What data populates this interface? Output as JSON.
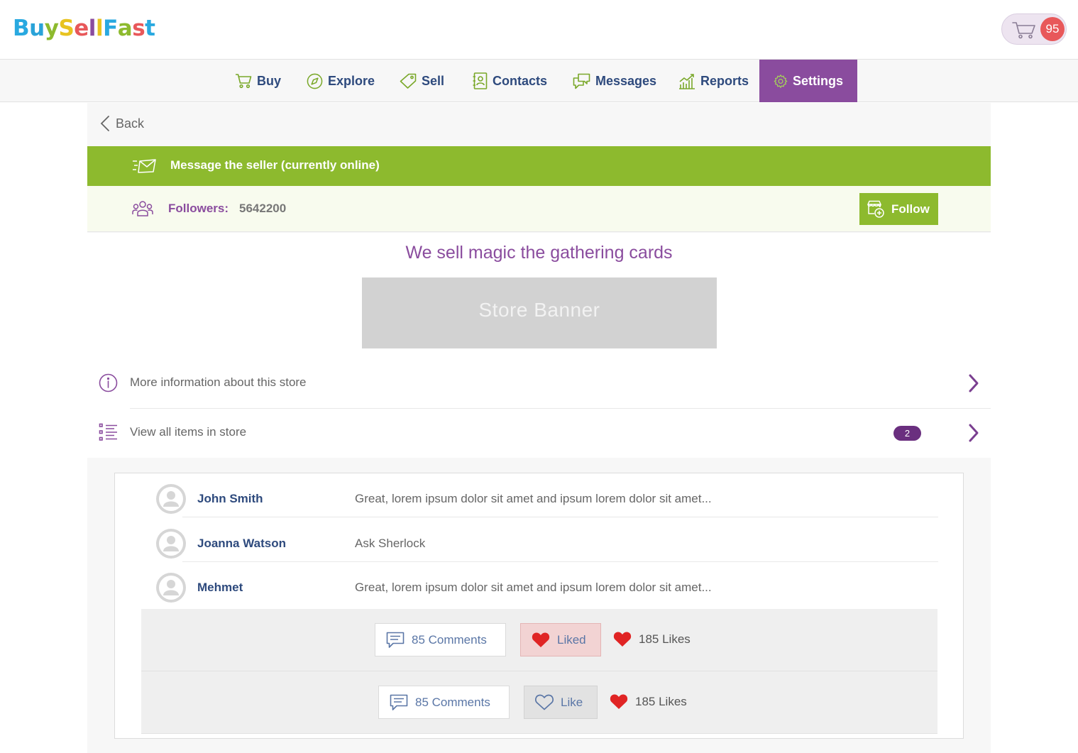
{
  "app": {
    "logo_letters": [
      {
        "ch": "B",
        "color": "#29a9e0"
      },
      {
        "ch": "u",
        "color": "#2aa3d8"
      },
      {
        "ch": "y",
        "color": "#8dba2e"
      },
      {
        "ch": "S",
        "color": "#e8c320"
      },
      {
        "ch": "e",
        "color": "#e8585a"
      },
      {
        "ch": "l",
        "color": "#8a4c9e"
      },
      {
        "ch": "l",
        "color": "#e8c320"
      },
      {
        "ch": "F",
        "color": "#29a9e0"
      },
      {
        "ch": "a",
        "color": "#8dba2e"
      },
      {
        "ch": "s",
        "color": "#e8585a"
      },
      {
        "ch": "t",
        "color": "#29a9e0"
      }
    ],
    "cart_count": "95"
  },
  "nav": {
    "items": [
      {
        "label": "Buy",
        "icon": "cart-icon"
      },
      {
        "label": "Explore",
        "icon": "compass-icon"
      },
      {
        "label": "Sell",
        "icon": "tag-icon"
      },
      {
        "label": "Contacts",
        "icon": "address-book-icon"
      },
      {
        "label": "Messages",
        "icon": "chat-icon"
      },
      {
        "label": "Reports",
        "icon": "chart-icon"
      },
      {
        "label": "Settings",
        "icon": "gear-icon",
        "active": true
      }
    ]
  },
  "store": {
    "back_label": "Back",
    "message_seller": "Message the seller (currently online)",
    "followers_label": "Followers:",
    "followers_count": "5642200",
    "follow_label": "Follow",
    "title": "We sell magic the gathering cards",
    "banner_label": "Store Banner",
    "more_info_label": "More information about this store",
    "view_items_label": "View all items in store",
    "items_count": "2"
  },
  "comments": [
    {
      "name": "John Smith",
      "text": "Great, lorem ipsum dolor sit amet and ipsum lorem dolor sit amet..."
    },
    {
      "name": "Joanna Watson",
      "text": "Ask Sherlock"
    },
    {
      "name": "Mehmet",
      "text": "Great, lorem ipsum dolor sit amet and ipsum lorem dolor sit amet..."
    }
  ],
  "actions": [
    {
      "comments_label": "85 Comments",
      "like_label": "Liked",
      "likes_label": "185 Likes",
      "liked": true
    },
    {
      "comments_label": "85 Comments",
      "like_label": "Like",
      "likes_label": "185 Likes",
      "liked": false
    }
  ],
  "colors": {
    "accent_purple": "#8a4c9e",
    "accent_green": "#8dba2e",
    "nav_text": "#2e4a7d",
    "heart_red": "#e02424"
  }
}
